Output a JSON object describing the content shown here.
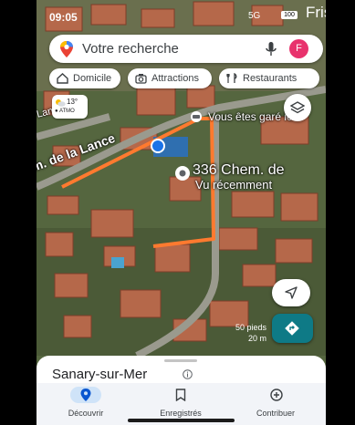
{
  "status": {
    "time": "09:05",
    "network": "5G",
    "battery": "100",
    "overlay_text": "Fris"
  },
  "search": {
    "placeholder": "Votre recherche",
    "avatar_letter": "F"
  },
  "chips": [
    {
      "label": "Domicile",
      "icon": "home-icon"
    },
    {
      "label": "Attractions",
      "icon": "camera-icon"
    },
    {
      "label": "Restaurants",
      "icon": "restaurant-icon"
    }
  ],
  "weather": {
    "temp": "13°",
    "source": "● ATMO"
  },
  "map": {
    "road_label_1": "Lang",
    "road_label_2": "m. de la Lance",
    "parked_label": "Vous êtes garé ic",
    "address_label": "336 Chem. de",
    "address_sub": "Vu récemment",
    "scale_ft": "50 pieds",
    "scale_m": "20 m",
    "route_color": "#ff7a2f",
    "location_dot_color": "#1a73e8"
  },
  "sheet": {
    "place": "Sanary-sur-Mer"
  },
  "nav": [
    {
      "label": "Découvrir",
      "icon": "explore-icon",
      "active": true
    },
    {
      "label": "Enregistrés",
      "icon": "bookmark-icon",
      "active": false
    },
    {
      "label": "Contribuer",
      "icon": "add-circle-icon",
      "active": false
    }
  ]
}
